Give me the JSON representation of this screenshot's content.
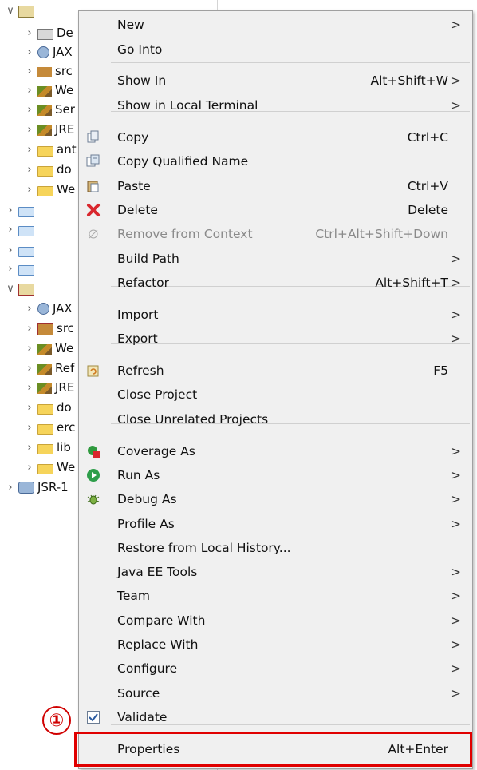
{
  "tree": {
    "items": [
      {
        "label": ""
      },
      {
        "label": "De"
      },
      {
        "label": "JAX"
      },
      {
        "label": "src"
      },
      {
        "label": "We"
      },
      {
        "label": "Ser"
      },
      {
        "label": "JRE"
      },
      {
        "label": "ant"
      },
      {
        "label": "do"
      },
      {
        "label": "We"
      },
      {
        "label": ""
      },
      {
        "label": ""
      },
      {
        "label": ""
      },
      {
        "label": ""
      },
      {
        "label": ""
      },
      {
        "label": "JAX"
      },
      {
        "label": "src"
      },
      {
        "label": "We"
      },
      {
        "label": "Ref"
      },
      {
        "label": "JRE"
      },
      {
        "label": "do"
      },
      {
        "label": "erc"
      },
      {
        "label": "lib"
      },
      {
        "label": "We"
      },
      {
        "label": "JSR-1"
      }
    ]
  },
  "menu": {
    "items": [
      {
        "label": "New",
        "shortcut": "",
        "submenu": true
      },
      {
        "label": "Go Into",
        "shortcut": "",
        "submenu": false
      },
      {
        "label": "Show In",
        "shortcut": "Alt+Shift+W",
        "submenu": true
      },
      {
        "label": "Show in Local Terminal",
        "shortcut": "",
        "submenu": true
      },
      {
        "label": "Copy",
        "shortcut": "Ctrl+C",
        "submenu": false,
        "icon": "copy-icon"
      },
      {
        "label": "Copy Qualified Name",
        "shortcut": "",
        "submenu": false,
        "icon": "copy-qualified-name-icon"
      },
      {
        "label": "Paste",
        "shortcut": "Ctrl+V",
        "submenu": false,
        "icon": "paste-icon"
      },
      {
        "label": "Delete",
        "shortcut": "Delete",
        "submenu": false,
        "icon": "delete-icon"
      },
      {
        "label": "Remove from Context",
        "shortcut": "Ctrl+Alt+Shift+Down",
        "submenu": false,
        "disabled": true,
        "icon": "remove-from-context-icon"
      },
      {
        "label": "Build Path",
        "shortcut": "",
        "submenu": true
      },
      {
        "label": "Refactor",
        "shortcut": "Alt+Shift+T",
        "submenu": true
      },
      {
        "label": "Import",
        "shortcut": "",
        "submenu": true
      },
      {
        "label": "Export",
        "shortcut": "",
        "submenu": true
      },
      {
        "label": "Refresh",
        "shortcut": "F5",
        "submenu": false,
        "icon": "refresh-icon"
      },
      {
        "label": "Close Project",
        "shortcut": "",
        "submenu": false
      },
      {
        "label": "Close Unrelated Projects",
        "shortcut": "",
        "submenu": false
      },
      {
        "label": "Coverage As",
        "shortcut": "",
        "submenu": true,
        "icon": "coverage-icon"
      },
      {
        "label": "Run As",
        "shortcut": "",
        "submenu": true,
        "icon": "run-icon"
      },
      {
        "label": "Debug As",
        "shortcut": "",
        "submenu": true,
        "icon": "debug-bug-icon"
      },
      {
        "label": "Profile As",
        "shortcut": "",
        "submenu": true
      },
      {
        "label": "Restore from Local History...",
        "shortcut": "",
        "submenu": false
      },
      {
        "label": "Java EE Tools",
        "shortcut": "",
        "submenu": true
      },
      {
        "label": "Team",
        "shortcut": "",
        "submenu": true
      },
      {
        "label": "Compare With",
        "shortcut": "",
        "submenu": true
      },
      {
        "label": "Replace With",
        "shortcut": "",
        "submenu": true
      },
      {
        "label": "Configure",
        "shortcut": "",
        "submenu": true
      },
      {
        "label": "Source",
        "shortcut": "",
        "submenu": true
      },
      {
        "label": "Validate",
        "shortcut": "",
        "submenu": false,
        "icon": "checkbox-checked-icon"
      },
      {
        "label": "Properties",
        "shortcut": "Alt+Enter",
        "submenu": false
      }
    ],
    "arrow_glyph": ">"
  },
  "annotation": {
    "marker_label": "①",
    "highlight_color": "#e00000"
  }
}
